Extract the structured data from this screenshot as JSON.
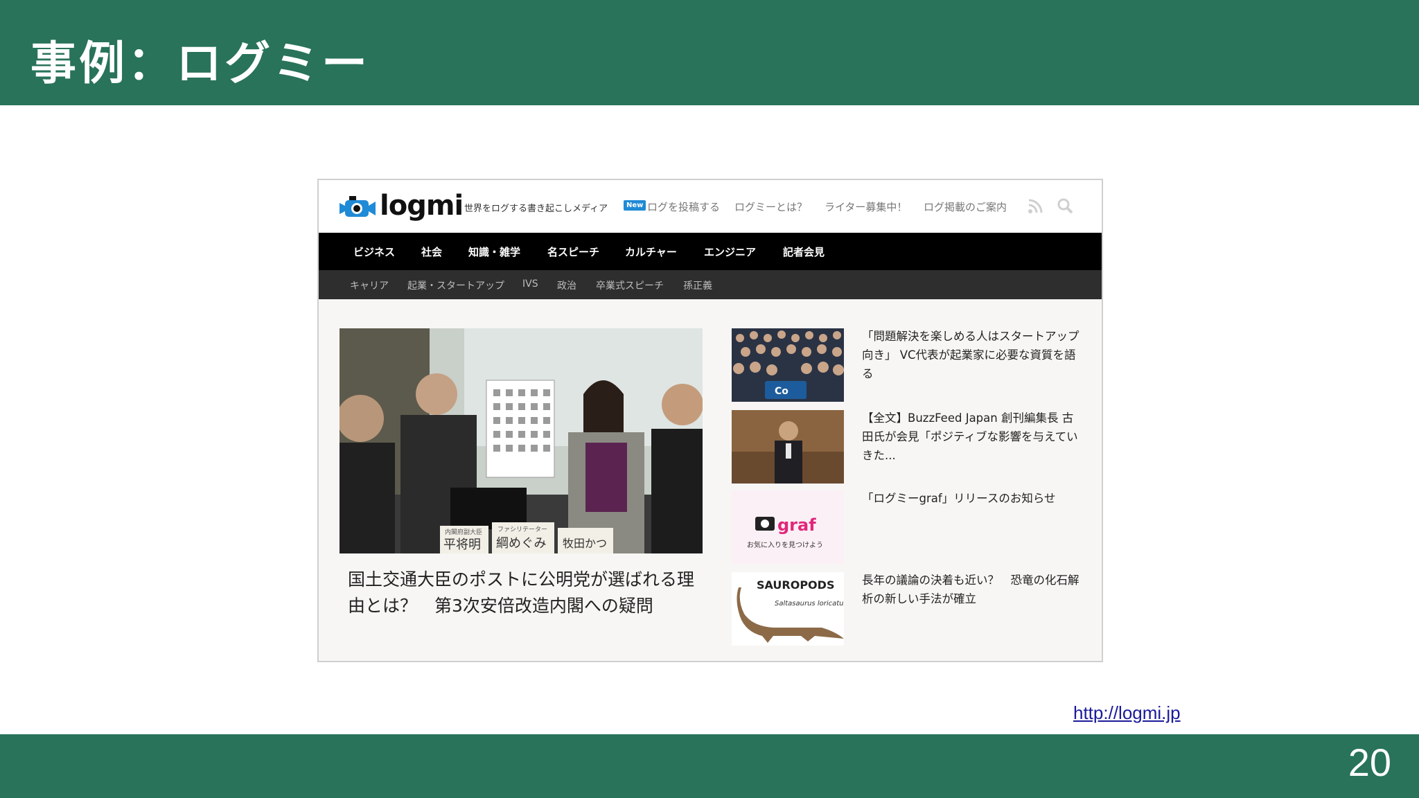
{
  "slide": {
    "title": "事例：ログミー",
    "page_number": "20",
    "source_link": "http://logmi.jp"
  },
  "site": {
    "logo_text": "logmi",
    "logo_sub": "ログミー",
    "tagline": "世界をログする書き起こしメディア",
    "new_badge": "New",
    "header_links": [
      "ログを投稿する",
      "ログミーとは？",
      "ライター募集中！",
      "ログ掲載のご案内"
    ],
    "nav_main": [
      "ビジネス",
      "社会",
      "知識・雑学",
      "名スピーチ",
      "カルチャー",
      "エンジニア",
      "記者会見"
    ],
    "nav_sub": [
      "キャリア",
      "起業・スタートアップ",
      "IVS",
      "政治",
      "卒業式スピーチ",
      "孫正義"
    ],
    "hero": {
      "image_labels": [
        "ファシリテーター",
        "綱めぐみ",
        "内閣府副大臣",
        "平将明",
        "牧田かつ"
      ],
      "title": "国土交通大臣のポストに公明党が選ばれる理由とは？　第3次安倍改造内閣への疑問"
    },
    "articles": [
      {
        "title": "「問題解決を楽しめる人はスタートアップ向き」 VC代表が起業家に必要な資質を語る",
        "thumb": "crowd-photo",
        "thumb_text": "Co"
      },
      {
        "title": "【全文】BuzzFeed Japan 創刊編集長 古田氏が会見「ポジティブな影響を与えていきた...",
        "thumb": "speaker-photo"
      },
      {
        "title": "「ログミーgraf」リリースのお知らせ",
        "thumb": "graf-logo",
        "thumb_text": "graf",
        "thumb_sub": "お気に入りを見つけよう"
      },
      {
        "title": "長年の議論の決着も近い？　恐竜の化石解析の新しい手法が確立",
        "thumb": "dinosaur",
        "thumb_text": "SAUROPODS",
        "thumb_sub": "Saltasaurus loricatus"
      }
    ]
  },
  "colors": {
    "slide_bar": "#28735a",
    "nav_main_bg": "#000000",
    "nav_sub_bg": "#2e2e2e",
    "badge": "#1f8ad6",
    "graf_pink": "#e0287a"
  },
  "icons": [
    "camera-logo-icon",
    "rss-icon",
    "search-icon"
  ]
}
